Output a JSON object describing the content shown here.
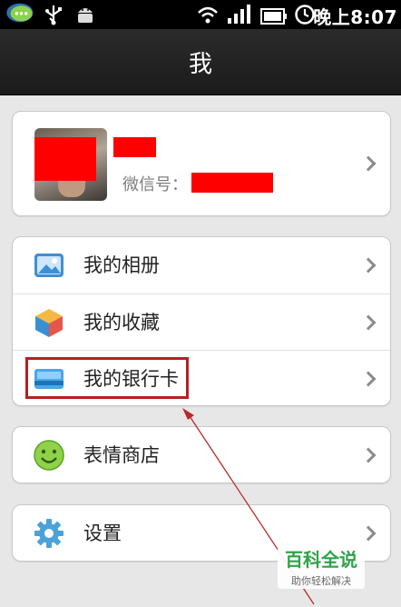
{
  "status_bar": {
    "time": "晚上8:07",
    "icons": [
      "chat-bubble-icon",
      "usb-icon",
      "android-icon",
      "wifi-icon",
      "signal-icon",
      "battery-icon",
      "clock-icon"
    ]
  },
  "header": {
    "title": "我"
  },
  "profile": {
    "wechat_id_label": "微信号："
  },
  "menu_group_1": [
    {
      "label": "我的相册",
      "icon": "album-icon"
    },
    {
      "label": "我的收藏",
      "icon": "favorites-icon"
    },
    {
      "label": "我的银行卡",
      "icon": "bank-card-icon"
    }
  ],
  "menu_group_2": [
    {
      "label": "表情商店",
      "icon": "sticker-store-icon"
    }
  ],
  "menu_group_3": [
    {
      "label": "设置",
      "icon": "settings-gear-icon"
    }
  ],
  "colors": {
    "highlight_border": "#b52020",
    "redaction": "#ff0000",
    "arrow": "#b52a2a",
    "watermark_green": "#2ea34a"
  },
  "watermark": {
    "title": "百科全说",
    "subtitle": "助你轻松解决"
  }
}
